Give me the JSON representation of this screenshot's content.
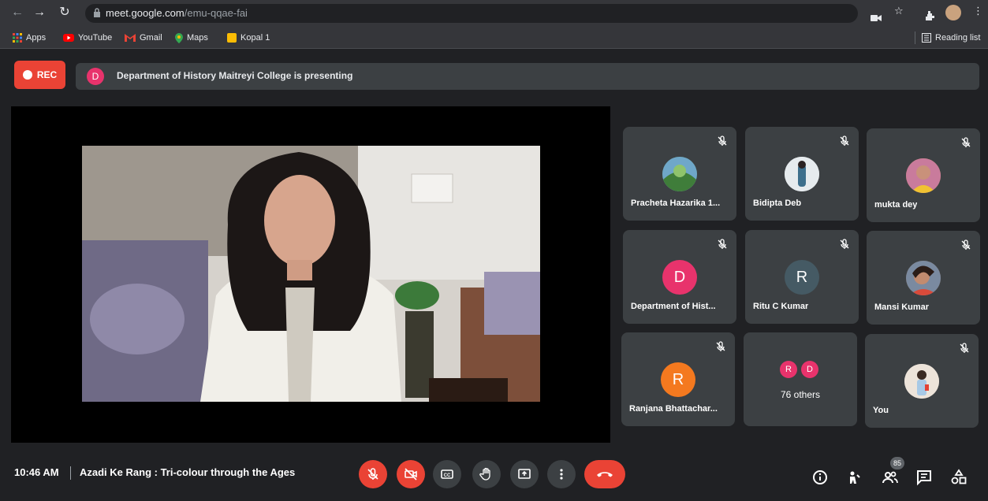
{
  "browser": {
    "url_host": "meet.google.com",
    "url_path": "/emu-qqae-fai",
    "reading_list": "Reading list"
  },
  "bookmarks": [
    "Apps",
    "YouTube",
    "Gmail",
    "Maps",
    "Kopal 1"
  ],
  "recording": {
    "label": "REC"
  },
  "presenter": {
    "initial": "D",
    "text": "Department of History Maitreyi College is presenting"
  },
  "participants": [
    {
      "name": "Pracheta Hazarika 1...",
      "avatar": "photo",
      "color": "#5a8f5a"
    },
    {
      "name": "Bidipta Deb",
      "avatar": "photo",
      "color": "#8aa3b8"
    },
    {
      "name": "mukta dey",
      "avatar": "photo",
      "color": "#d9a24b"
    },
    {
      "name": "Department of Hist...",
      "avatar": "D",
      "color": "#e8336c"
    },
    {
      "name": "Ritu C Kumar",
      "avatar": "R",
      "color": "#455a64"
    },
    {
      "name": "Mansi Kumar",
      "avatar": "photo",
      "color": "#9c6b4f"
    },
    {
      "name": "Ranjana Bhattachar...",
      "avatar": "R",
      "color": "#f4791f"
    },
    {
      "name": "You",
      "avatar": "photo",
      "color": "#d8cfc4"
    }
  ],
  "others": {
    "initials": [
      "R",
      "D"
    ],
    "label": "76 others"
  },
  "footer": {
    "time": "10:46 AM",
    "meeting_title": "Azadi Ke Rang : Tri-colour through the Ages",
    "people_count": "85"
  },
  "colors": {
    "accent_red": "#ea4335",
    "tile_bg": "#3c4043",
    "bg": "#202124"
  }
}
